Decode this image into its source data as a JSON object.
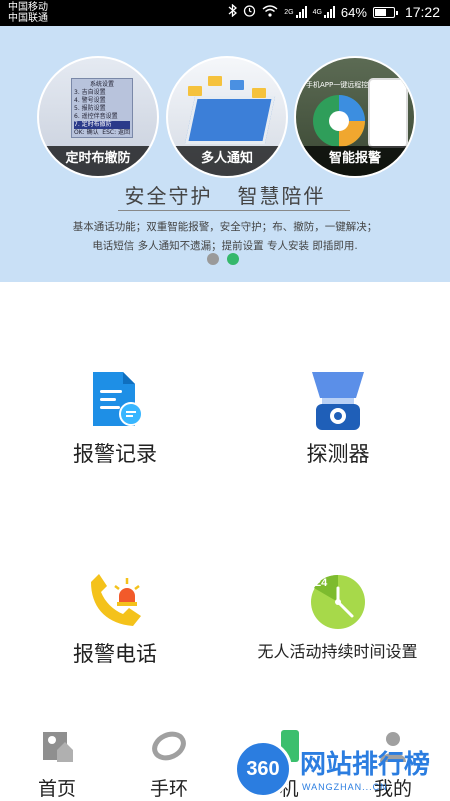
{
  "status_bar": {
    "carrier_1": "中国移动",
    "carrier_2": "中国联通",
    "network_1": "2G",
    "network_2": "4G",
    "battery": "64%",
    "battery_level": 0.64,
    "time": "17:22"
  },
  "banner": {
    "slides": [
      {
        "caption": "定时布撤防",
        "screen_lines": [
          "系统设置",
          "3. 吉自设置",
          "4. 警号设置",
          "5. 报防设置",
          "6. 遥控伴音设置"
        ],
        "screen_selected": "7. 定时布撤防",
        "screen_footer": [
          "OK: 确认",
          "ESC: 返回"
        ]
      },
      {
        "caption": "多人通知"
      },
      {
        "caption": "智能报警",
        "app_title": "手机APP一键远程控制"
      }
    ],
    "tagline": "安全守护   智慧陪伴",
    "desc_line_1": "基本通话功能；双重智能报警，安全守护；布、撤防，一键解决；",
    "desc_line_2": "电话短信 多人通知不遗漏；提前设置 专人安装 即插即用."
  },
  "grid": {
    "alarm_records": "报警记录",
    "detector": "探测器",
    "alarm_phone": "报警电话",
    "inactivity_setting": "无人活动持续时间设置",
    "clock_number": "24"
  },
  "tabbar": {
    "home": "首页",
    "band": "手环",
    "phone_partial": "机",
    "mine": "我的"
  },
  "watermark": {
    "badge": "360",
    "title": "网站排行榜",
    "subtitle": "WANGZHAN...CN"
  },
  "colors": {
    "banner_bg": "#c9e0f6",
    "accent_green": "#35b86b",
    "icon_blue": "#2a8fe0",
    "icon_yellow": "#f4c21b",
    "icon_green": "#8fce3a",
    "watermark_blue": "#2b7de0"
  }
}
